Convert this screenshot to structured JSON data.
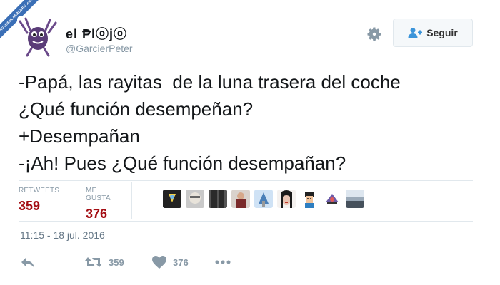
{
  "watermark": {
    "text": "VISTOENLASREDES .com"
  },
  "tweet": {
    "display_name": "el ₱lⓞjⓞ",
    "username": "@GarcierPeter",
    "text_lines": [
      "-Papá, las rayitas  de la luna trasera del coche",
      "¿Qué función desempeñan?",
      "+Desempañan",
      "-¡Ah! Pues ¿Qué función desempañan?"
    ],
    "timestamp": "11:15 - 18 jul. 2016"
  },
  "header": {
    "follow_label": "Seguir",
    "settings_icon": "gear-icon",
    "follow_icon": "add-user-icon"
  },
  "stats": {
    "retweets_label": "RETWEETS",
    "retweets_value": "359",
    "likes_label": "ME GUSTA",
    "likes_value": "376"
  },
  "actions": {
    "reply_icon": "reply-icon",
    "retweet_icon": "retweet-icon",
    "retweet_count": "359",
    "like_icon": "heart-icon",
    "like_count": "376",
    "more_icon": "more-dots-icon"
  },
  "colors": {
    "stat_value": "#a40e14",
    "muted": "#8899a6",
    "text": "#14171a",
    "border": "#e1e8ed"
  }
}
